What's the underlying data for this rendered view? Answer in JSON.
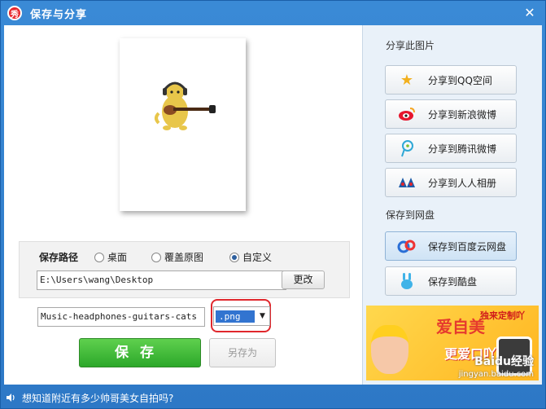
{
  "window": {
    "title": "保存与分享",
    "logo_text": "秀",
    "close_glyph": "✕"
  },
  "save_path": {
    "label": "保存路径",
    "options": [
      {
        "label": "桌面",
        "selected": false
      },
      {
        "label": "覆盖原图",
        "selected": false
      },
      {
        "label": "自定义",
        "selected": true
      }
    ],
    "path_value": "E:\\Users\\wang\\Desktop",
    "change_button": "更改"
  },
  "file": {
    "name_value": "Music-headphones-guitars-cats",
    "format_value": ".png",
    "format_dropdown_icon": "triangle-down-icon"
  },
  "actions": {
    "save_label": "保存",
    "save_as_label": "另存为"
  },
  "share_section": {
    "title": "分享此图片",
    "buttons": [
      {
        "label": "分享到QQ空间",
        "icon": "qzone-star-icon"
      },
      {
        "label": "分享到新浪微博",
        "icon": "sina-weibo-icon"
      },
      {
        "label": "分享到腾讯微博",
        "icon": "tencent-weibo-icon"
      },
      {
        "label": "分享到人人相册",
        "icon": "renren-icon"
      }
    ]
  },
  "cloud_section": {
    "title": "保存到网盘",
    "buttons": [
      {
        "label": "保存到百度云网盘",
        "icon": "baidu-cloud-icon",
        "active": true
      },
      {
        "label": "保存到酷盘",
        "icon": "kupan-rabbit-icon",
        "active": false
      }
    ]
  },
  "ad": {
    "headline": "爱自美",
    "tag": "独来定制吖",
    "subline": "更爱口吖",
    "watermark": "Baidu经验",
    "watermark_url": "jingyan.baidu.com"
  },
  "status": {
    "text": "想知道附近有多少帅哥美女自拍吗?"
  },
  "colors": {
    "title_bar": "#2f7fcf",
    "save_green": "#2ca82a",
    "highlight_red": "#e0272c",
    "format_selection": "#3274d0"
  }
}
